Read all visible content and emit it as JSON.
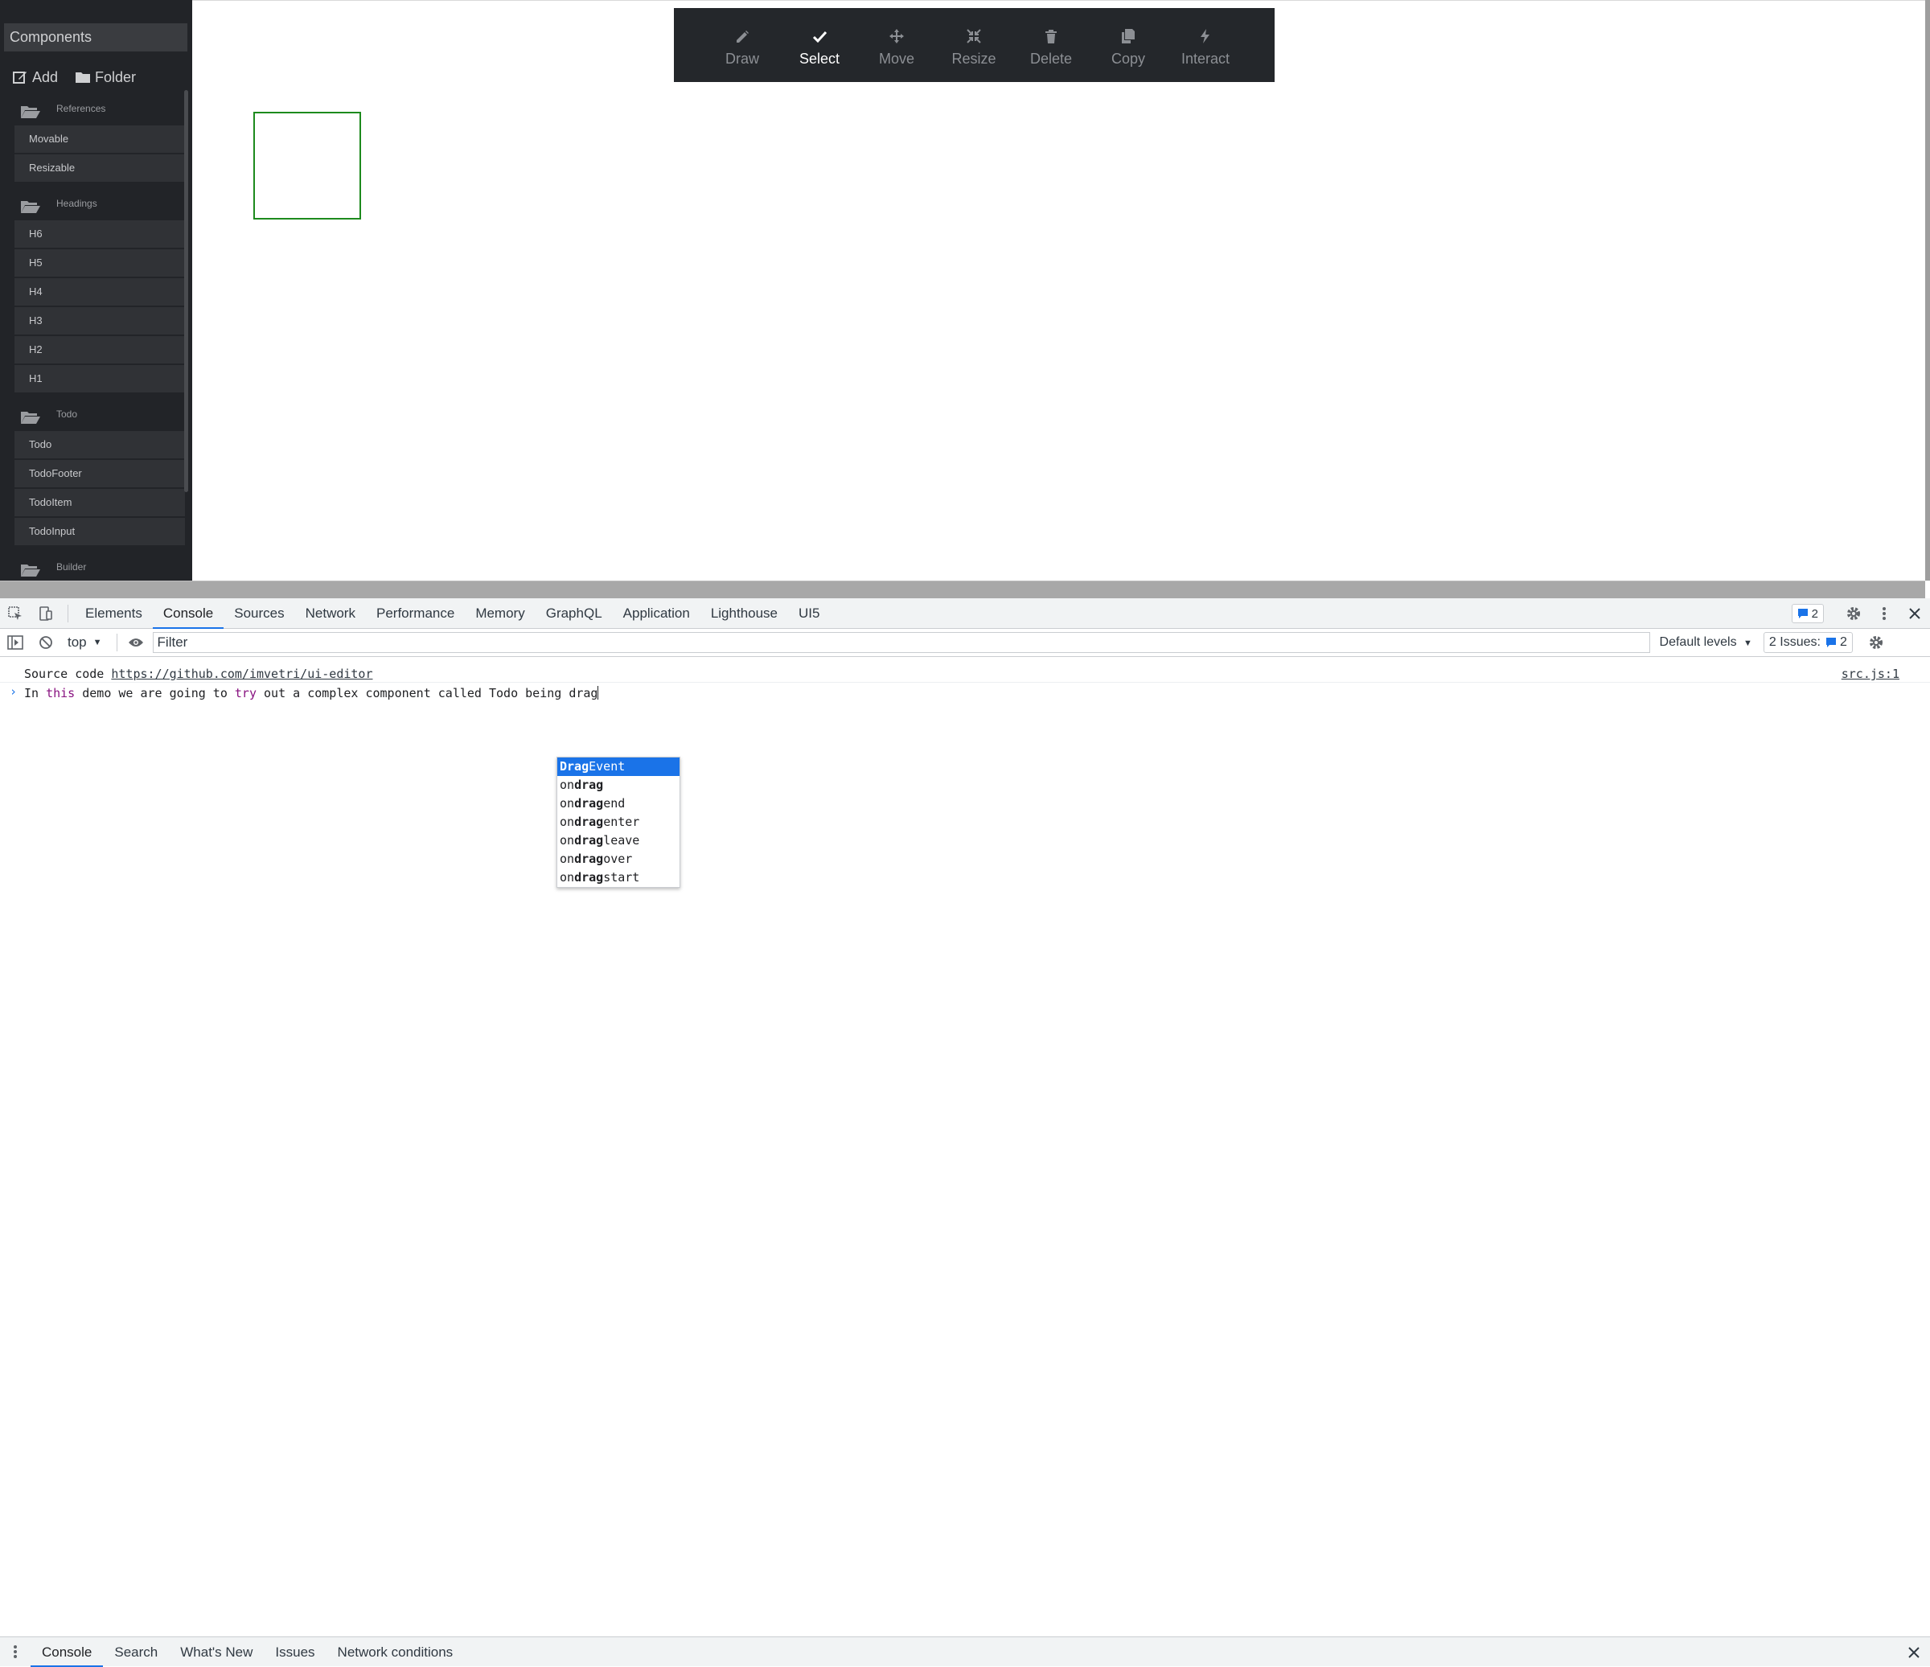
{
  "sidebar": {
    "title": "Components",
    "actions": {
      "add": "Add",
      "folder": "Folder"
    },
    "groups": [
      {
        "label": "References",
        "items": [
          "Movable",
          "Resizable"
        ]
      },
      {
        "label": "Headings",
        "items": [
          "H6",
          "H5",
          "H4",
          "H3",
          "H2",
          "H1"
        ]
      },
      {
        "label": "Todo",
        "items": [
          "Todo",
          "TodoFooter",
          "TodoItem",
          "TodoInput"
        ]
      },
      {
        "label": "Builder",
        "items": []
      }
    ]
  },
  "toolbar": {
    "tools": [
      {
        "label": "Draw",
        "icon": "pencil-icon",
        "active": false
      },
      {
        "label": "Select",
        "icon": "check-icon",
        "active": true
      },
      {
        "label": "Move",
        "icon": "move-icon",
        "active": false
      },
      {
        "label": "Resize",
        "icon": "compress-icon",
        "active": false
      },
      {
        "label": "Delete",
        "icon": "trash-icon",
        "active": false
      },
      {
        "label": "Copy",
        "icon": "copy-icon",
        "active": false
      },
      {
        "label": "Interact",
        "icon": "bolt-icon",
        "active": false
      }
    ]
  },
  "devtools": {
    "tabs": [
      "Elements",
      "Console",
      "Sources",
      "Network",
      "Performance",
      "Memory",
      "GraphQL",
      "Application",
      "Lighthouse",
      "UI5"
    ],
    "active_tab": "Console",
    "messages_badge": "2",
    "console_bar": {
      "context": "top",
      "filter_placeholder": "Filter",
      "levels": "Default levels",
      "issues_label": "2 Issues:",
      "issues_count": "2"
    },
    "log": {
      "prefix": "Source code ",
      "link": "https://github.com/imvetri/ui-editor",
      "source": "src.js:1"
    },
    "input": {
      "part1": "In ",
      "kw1": "this",
      "part2": " demo we are going to ",
      "kw2": "try",
      "part3": " out a complex component called Todo being drag"
    },
    "autocomplete": [
      {
        "pre": "",
        "bold": "Drag",
        "post": "Event"
      },
      {
        "pre": "on",
        "bold": "drag",
        "post": ""
      },
      {
        "pre": "on",
        "bold": "drag",
        "post": "end"
      },
      {
        "pre": "on",
        "bold": "drag",
        "post": "enter"
      },
      {
        "pre": "on",
        "bold": "drag",
        "post": "leave"
      },
      {
        "pre": "on",
        "bold": "drag",
        "post": "over"
      },
      {
        "pre": "on",
        "bold": "drag",
        "post": "start"
      }
    ],
    "drawer_tabs": [
      "Console",
      "Search",
      "What's New",
      "Issues",
      "Network conditions"
    ]
  },
  "colors": {
    "accent": "#1a73e8",
    "toolbar_bg": "#24272b",
    "sidebar_bg": "#222428",
    "shape_border": "#1d8a1d"
  }
}
